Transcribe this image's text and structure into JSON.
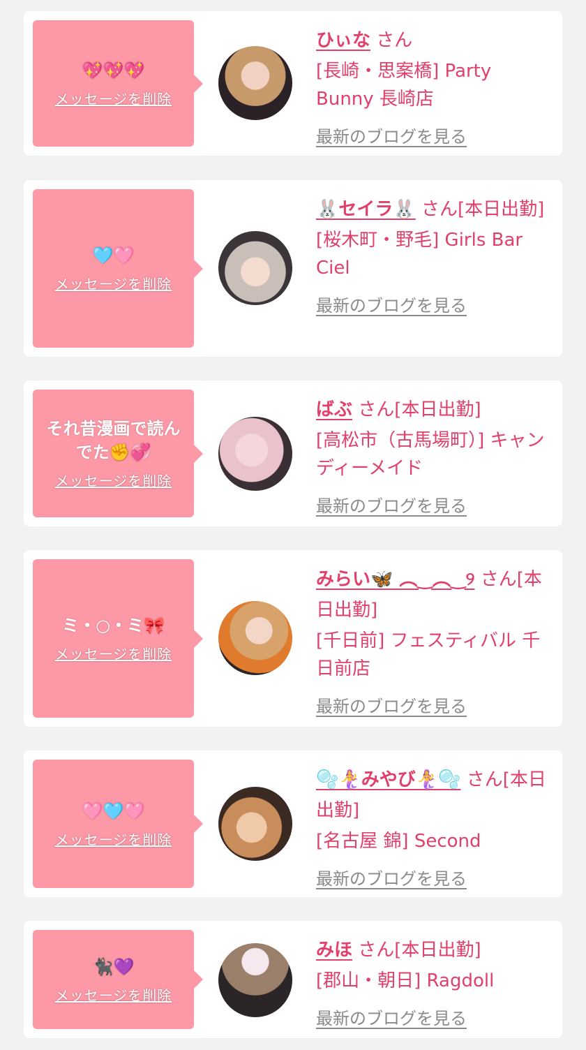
{
  "labels": {
    "delete": "メッセージを削除",
    "blog": "最新のブログを見る"
  },
  "colors": {
    "bubble": "#fd98a6",
    "accent": "#e0406a",
    "link_gray": "#8a8a8a"
  },
  "items": [
    {
      "message": "💖💖💖",
      "name": "ひぃな",
      "suffix": "さん",
      "tag": "",
      "shop": "[長崎・思案橋] Party Bunny 長崎店"
    },
    {
      "message": "🩵🩷",
      "name": "🐰セイラ🐰",
      "suffix": "さん",
      "tag": "[本日出勤]",
      "shop": "[桜木町・野毛] Girls Bar Ciel"
    },
    {
      "message": "それ昔漫画で読んでた✊💞",
      "name": "ばぶ",
      "suffix": "さん",
      "tag": "[本日出勤]",
      "shop": "[高松市（古馬場町）] キャンディーメイド"
    },
    {
      "message": "ミ・○・ミ🎀",
      "name": "みらい🦋 ︵‿︵‿୨",
      "suffix": "さん",
      "tag": "[本日出勤]",
      "shop": "[千日前] フェスティバル 千日前店"
    },
    {
      "message": "🩷🩵🩷",
      "name": "🫧🧜‍♀️みやび🧜‍♀️🫧",
      "suffix": "さん",
      "tag": "[本日出勤]",
      "shop": "[名古屋 錦] Second"
    },
    {
      "message": "🐈‍⬛💜",
      "name": "みほ",
      "suffix": "さん",
      "tag": "[本日出勤]",
      "shop": "[郡山・朝日] Ragdoll"
    }
  ]
}
